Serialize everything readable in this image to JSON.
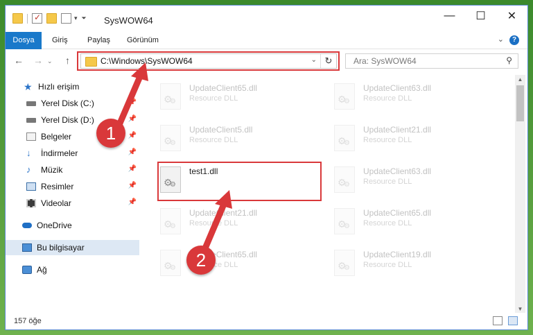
{
  "window": {
    "title": "SysWOW64"
  },
  "window_controls": {
    "minimize": "—",
    "maximize": "☐",
    "close": "✕"
  },
  "ribbon": {
    "tabs": [
      "Dosya",
      "Giriş",
      "Paylaş",
      "Görünüm"
    ],
    "help": "?"
  },
  "nav": {
    "back": "←",
    "forward": "→",
    "up": "↑",
    "address": "C:\\Windows\\SysWOW64",
    "refresh": "↻",
    "search_placeholder": "Ara: SysWOW64"
  },
  "sidebar": {
    "quick_access": "Hızlı erişim",
    "items": [
      {
        "label": "Yerel Disk (C:)",
        "icon": "drive-icon"
      },
      {
        "label": "Yerel Disk (D:)",
        "icon": "drive-icon"
      },
      {
        "label": "Belgeler",
        "icon": "documents-icon"
      },
      {
        "label": "İndirmeler",
        "icon": "download-icon"
      },
      {
        "label": "Müzik",
        "icon": "music-icon"
      },
      {
        "label": "Resimler",
        "icon": "pictures-icon"
      },
      {
        "label": "Videolar",
        "icon": "video-icon"
      }
    ],
    "onedrive": "OneDrive",
    "this_pc": "Bu bilgisayar",
    "network": "Ağ"
  },
  "files": [
    {
      "name": "UpdateClient65.dll",
      "type": "Resource DLL"
    },
    {
      "name": "UpdateClient63.dll",
      "type": "Resource DLL"
    },
    {
      "name": "UpdateClient5.dll",
      "type": "Resource DLL"
    },
    {
      "name": "UpdateClient21.dll",
      "type": "Resource DLL"
    },
    {
      "name": "test1.dll",
      "type": ""
    },
    {
      "name": "UpdateClient63.dll",
      "type": "Resource DLL"
    },
    {
      "name": "UpdateClient21.dll",
      "type": "Resource DLL"
    },
    {
      "name": "UpdateClient65.dll",
      "type": "Resource DLL"
    },
    {
      "name": "UpdateClient65.dll",
      "type": "Resource DLL"
    },
    {
      "name": "UpdateClient19.dll",
      "type": "Resource DLL"
    }
  ],
  "status": {
    "item_count": "157 öğe"
  },
  "callouts": [
    "1",
    "2"
  ],
  "colors": {
    "accent": "#1979ca",
    "highlight": "#d9383a",
    "selected": "#dde8f4"
  }
}
